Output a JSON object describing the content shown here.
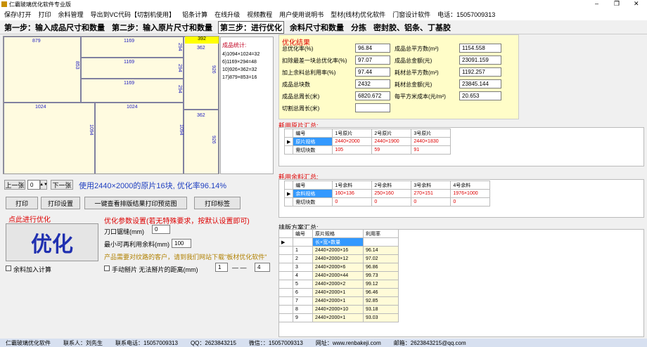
{
  "window": {
    "title": "仁霸玻璃优化软件专业版"
  },
  "menu": [
    "保存\\打开",
    "打印",
    "余料管理",
    "导出到VC代码【切割机使用】",
    "铝条计算",
    "在线升级",
    "视频教程",
    "用户使用说明书",
    "型材(线材)优化软件",
    "门窗设计软件",
    "电话：15057009313"
  ],
  "steps": [
    "第一步：输入成品尺寸和数量",
    "第二步：输入原片尺寸和数量",
    "第三步：进行优化",
    "余料尺寸和数量",
    "分拣",
    "密封胶、铝条、丁基胶"
  ],
  "layout": {
    "top_right": "392",
    "labels": [
      "879",
      "1169",
      "1169",
      "1169",
      "853",
      "294",
      "294",
      "294",
      "362",
      "926",
      "362",
      "926",
      "1024",
      "1024",
      "1094",
      "1094"
    ]
  },
  "pieces": {
    "title": "成品统计:",
    "items": [
      "4)1094×1024=32",
      "6)1169×294=48",
      "10)926×362=32",
      "17)879×853=16"
    ]
  },
  "nav": {
    "prev": "上一张",
    "page": "0",
    "next": "下一张",
    "info": "使用2440×2000的原片16块, 优化率96.14%"
  },
  "buttons": {
    "print": "打印",
    "print_setup": "打印设置",
    "preview": "一键查看排版结果打印预览图",
    "print_label": "打印标签"
  },
  "optimize": {
    "hint": "点此进行优化",
    "button": "优化",
    "leftover": "余料加入计算"
  },
  "settings": {
    "title": "优化参数设置(若无特殊要求，按默认设置即可)",
    "kerf_label": "刀口锯缝(mm)",
    "kerf": "0",
    "min_label": "最小可再利用余料(mm)",
    "min": "100",
    "note": "产品需要对纹路的客户，请到我们网站下载\"板材优化软件\"",
    "manual_label": "手动掰片 无法掰片的距离(mm)",
    "d1": "1",
    "dash": "— —",
    "d2": "4"
  },
  "result": {
    "title": "优化结果",
    "rows": [
      [
        "总优化率(%)",
        "96.84",
        "成品总平方数(m²)",
        "1154.558"
      ],
      [
        "扣除最差一块总优化率(%)",
        "97.07",
        "成品总金额(元)",
        "23091.159"
      ],
      [
        "加上余料总利用率(%)",
        "97.44",
        "耗材总平方数(m²)",
        "1192.257"
      ],
      [
        "成品总块数",
        "2432",
        "耗材总金额(元)",
        "23845.144"
      ],
      [
        "成品总周长(米)",
        "6820.672",
        "每平方米成本(元/m²)",
        "20.653"
      ],
      [
        "切割总周长(米)",
        "",
        "",
        ""
      ]
    ]
  },
  "sheet_summary": {
    "title": "耗用原片汇总:",
    "header": [
      "编号",
      "1号原片",
      "2号原片",
      "3号原片"
    ],
    "rows": [
      [
        "原片规格",
        "2440×2000",
        "2440×1900",
        "2440×1830"
      ],
      [
        "需切块数",
        "105",
        "59",
        "91"
      ]
    ]
  },
  "leftover_summary": {
    "title": "耗用余料汇总:",
    "header": [
      "编号",
      "1号余料",
      "2号余料",
      "3号余料",
      "4号余料"
    ],
    "rows": [
      [
        "余料规格",
        "160×136",
        "250×160",
        "270×151",
        "1976×1000"
      ],
      [
        "需切块数",
        "0",
        "0",
        "0",
        "0"
      ]
    ]
  },
  "plan": {
    "title": "排版方案汇总:",
    "header": [
      "编号",
      "原片规格",
      "利用率"
    ],
    "first": "长×宽×数量",
    "rows": [
      [
        "1",
        "2440×2000×16",
        "96.14"
      ],
      [
        "2",
        "2440×2000×12",
        "97.02"
      ],
      [
        "3",
        "2440×2000×6",
        "96.86"
      ],
      [
        "4",
        "2440×2000×44",
        "99.73"
      ],
      [
        "5",
        "2440×2000×2",
        "99.12"
      ],
      [
        "6",
        "2440×2000×1",
        "96.46"
      ],
      [
        "7",
        "2440×2000×1",
        "92.85"
      ],
      [
        "8",
        "2440×2000×10",
        "93.18"
      ],
      [
        "9",
        "2440×2000×1",
        "93.03"
      ]
    ]
  },
  "status": [
    "仁霸玻璃优化软件",
    "联系人：刘先生",
    "联系电话：15057009313",
    "QQ：2623843215",
    "微信：：15057009313",
    "网址：www.renbakeji.com",
    "邮箱：2623843215@qq.com"
  ]
}
